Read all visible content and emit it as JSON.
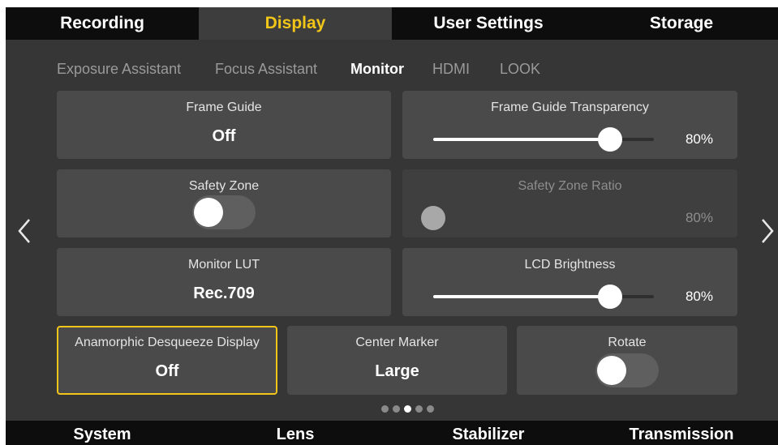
{
  "top_tabs": [
    {
      "label": "Recording",
      "active": false
    },
    {
      "label": "Display",
      "active": true
    },
    {
      "label": "User Settings",
      "active": false
    },
    {
      "label": "Storage",
      "active": false
    }
  ],
  "sub_tabs": [
    {
      "label": "Exposure Assistant",
      "active": false
    },
    {
      "label": "Focus Assistant",
      "active": false
    },
    {
      "label": "Monitor",
      "active": true
    },
    {
      "label": "HDMI",
      "active": false
    },
    {
      "label": "LOOK",
      "active": false
    }
  ],
  "settings": {
    "frame_guide": {
      "label": "Frame Guide",
      "value": "Off"
    },
    "frame_guide_transparency": {
      "label": "Frame Guide Transparency",
      "value": "80%",
      "fraction": 0.8
    },
    "safety_zone": {
      "label": "Safety Zone",
      "enabled": false
    },
    "safety_zone_ratio": {
      "label": "Safety Zone Ratio",
      "value": "80%",
      "disabled": true
    },
    "monitor_lut": {
      "label": "Monitor LUT",
      "value": "Rec.709"
    },
    "lcd_brightness": {
      "label": "LCD Brightness",
      "value": "80%",
      "fraction": 0.8
    },
    "anamorphic_desqueeze": {
      "label": "Anamorphic Desqueeze Display",
      "value": "Off",
      "selected": true
    },
    "center_marker": {
      "label": "Center Marker",
      "value": "Large"
    },
    "rotate": {
      "label": "Rotate",
      "enabled": false
    }
  },
  "pagination": {
    "total": 5,
    "current": 3
  },
  "bottom_tabs": [
    {
      "label": "System"
    },
    {
      "label": "Lens"
    },
    {
      "label": "Stabilizer"
    },
    {
      "label": "Transmission"
    }
  ],
  "icons": {
    "prev": "chevron-left-icon",
    "next": "chevron-right-icon"
  },
  "colors": {
    "accent": "#f2c519",
    "background": "#363636",
    "card": "#4a4a4a",
    "bar": "#0d0d0d"
  }
}
